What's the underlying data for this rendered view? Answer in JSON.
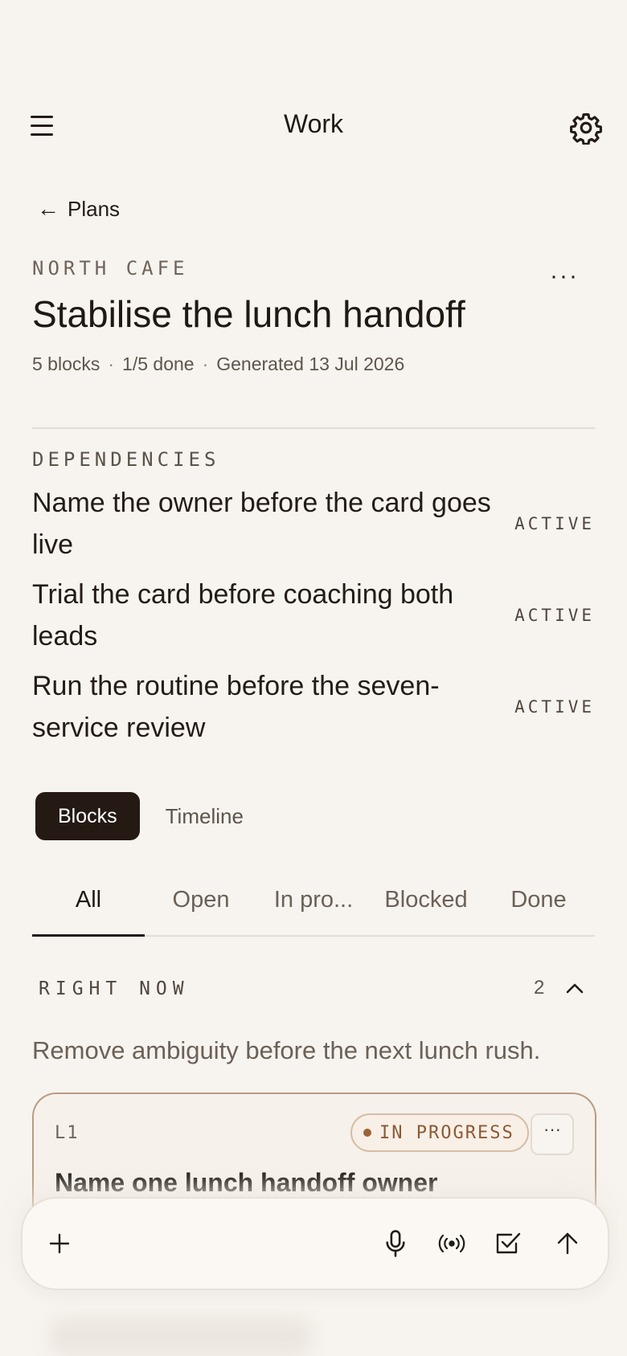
{
  "header": {
    "title": "Work"
  },
  "back": {
    "label": "Plans"
  },
  "plan": {
    "eyebrow": "NORTH CAFE",
    "title": "Stabilise the lunch handoff",
    "meta": {
      "blocks": "5 blocks",
      "done": "1/5 done",
      "generated": "Generated 13 Jul 2026"
    }
  },
  "dependencies": {
    "heading": "DEPENDENCIES",
    "items": [
      {
        "text": "Name the owner before the card goes live",
        "status": "ACTIVE"
      },
      {
        "text": "Trial the card before coaching both leads",
        "status": "ACTIVE"
      },
      {
        "text": "Run the routine before the seven-service review",
        "status": "ACTIVE"
      }
    ]
  },
  "view_toggle": {
    "active": "Blocks",
    "inactive": "Timeline"
  },
  "filters": [
    {
      "label": "All"
    },
    {
      "label": "Open"
    },
    {
      "label": "In pro..."
    },
    {
      "label": "Blocked"
    },
    {
      "label": "Done"
    }
  ],
  "section": {
    "heading": "RIGHT NOW",
    "count": "2",
    "description": "Remove ambiguity before the next lunch rush."
  },
  "card": {
    "id": "L1",
    "status": "IN PROGRESS",
    "more": "···",
    "title": "Name one lunch handoff owner"
  },
  "colors": {
    "accent_dark": "#241a13",
    "progress": "#9c6238",
    "background": "#f7f3ee"
  },
  "icons": [
    "menu-icon",
    "settings-gear-icon",
    "back-arrow-icon",
    "more-icon",
    "chevron-up-icon",
    "plus-icon",
    "microphone-icon",
    "broadcast-icon",
    "checkbox-icon",
    "send-arrow-icon"
  ]
}
